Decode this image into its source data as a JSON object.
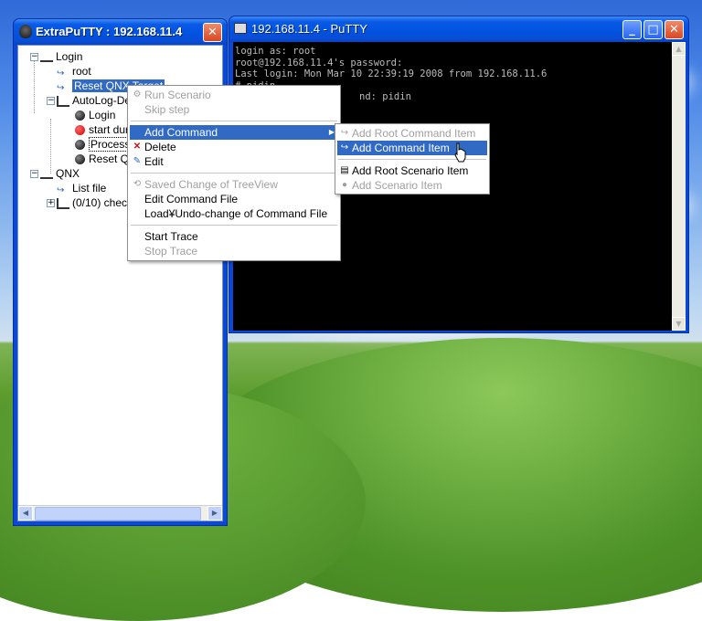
{
  "extraputty": {
    "title": "ExtraPuTTY : 192.168.11.4",
    "tree": {
      "login": "Login",
      "root": "root",
      "reset_qnx_target": "Reset QNX Target",
      "autolog": "AutoLog-De",
      "autolog_login": "Login",
      "start_dur": "start dur",
      "process": "Process",
      "reset_q": "Reset Q",
      "qnx": "QNX",
      "list_file": "List file",
      "check": "(0/10) check"
    }
  },
  "putty": {
    "title": "192.168.11.4 - PuTTY",
    "terminal_lines": [
      "login as: root",
      "root@192.168.11.4's password:",
      "Last login: Mon Mar 10 22:39:19 2008 from 192.168.11.6",
      "# pidin",
      "nd: pidin"
    ]
  },
  "context_menu": {
    "items": [
      {
        "label": "Run Scenario",
        "disabled": true
      },
      {
        "label": "Skip step",
        "disabled": true
      },
      {
        "label": "Add Command",
        "highlighted": true
      },
      {
        "label": "Delete"
      },
      {
        "label": "Edit"
      },
      {
        "label": "Saved Change of TreeView",
        "disabled": true
      },
      {
        "label": "Edit Command File"
      },
      {
        "label": "Load¥Undo-change of  Command File"
      },
      {
        "label": "Start Trace"
      },
      {
        "label": "Stop Trace",
        "disabled": true
      }
    ]
  },
  "submenu": {
    "items": [
      {
        "label": "Add Root Command Item",
        "disabled": true
      },
      {
        "label": "Add Command Item",
        "highlighted": true
      },
      {
        "label": "Add Root Scenario Item"
      },
      {
        "label": "Add Scenario Item",
        "disabled": true
      }
    ]
  }
}
